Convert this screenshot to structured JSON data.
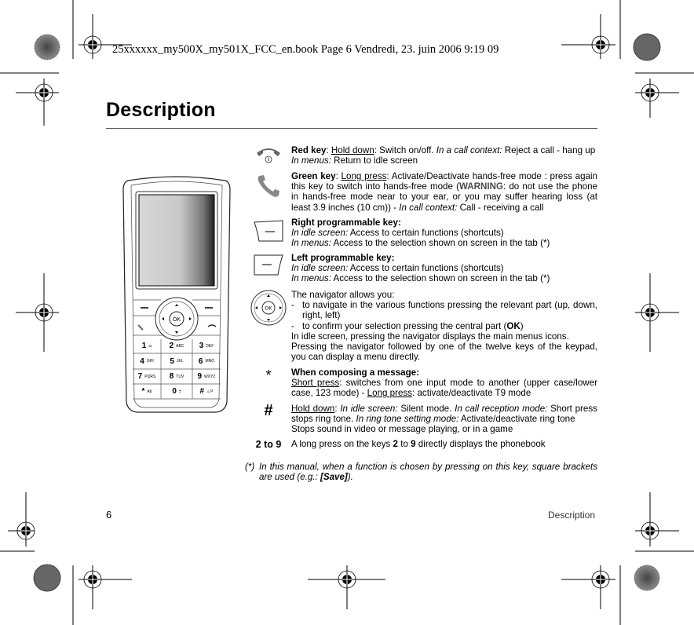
{
  "print_header": "25xxxxxx_my500X_my501X_FCC_en.book  Page 6  Vendredi, 23. juin 2006  9:19 09",
  "page": {
    "title": "Description",
    "page_number": "6",
    "running_footer": "Description"
  },
  "phone": {
    "keys": [
      {
        "digit": "1",
        "letters": "ω"
      },
      {
        "digit": "2",
        "letters": "ABC"
      },
      {
        "digit": "3",
        "letters": "DEF"
      },
      {
        "digit": "4",
        "letters": "GHI"
      },
      {
        "digit": "5",
        "letters": "JKL"
      },
      {
        "digit": "6",
        "letters": "MNO"
      },
      {
        "digit": "7",
        "letters": "PQRS"
      },
      {
        "digit": "8",
        "letters": "TUV"
      },
      {
        "digit": "9",
        "letters": "WXYZ"
      },
      {
        "digit": "*",
        "letters": "Ab"
      },
      {
        "digit": "0",
        "letters": "±"
      },
      {
        "digit": "#",
        "letters": "♫ P"
      }
    ],
    "ok_label": "OK"
  },
  "entries": {
    "red_key": {
      "icon": "red-key-hangup-icon",
      "title": "Red key",
      "action1": "Hold down",
      "text1": ": Switch on/off. ",
      "ctx1": "In a call context:",
      "text2": " Reject a call - hang up",
      "ctx2": "In menus:",
      "text3": " Return to idle screen"
    },
    "green_key": {
      "icon": "green-key-call-icon",
      "title": "Green key",
      "action1": "Long press",
      "text1": ": Activate/Deactivate hands-free mode : press again this key to switch into hands-free mode (",
      "warning": "WARNING",
      "text2": ": do not use the phone in hands-free mode near to your ear, or you may suffer hearing loss (at least 3.9 inches (10 cm)) - ",
      "ctx1": "In call context:",
      "text3": " Call - receiving a call"
    },
    "right_key": {
      "icon": "right-softkey-icon",
      "title": "Right programmable key:",
      "ctx1": "In idle screen:",
      "text1": " Access to certain functions (shortcuts)",
      "ctx2": "In menus:",
      "text2": " Access to the selection shown on screen in the tab (*)"
    },
    "left_key": {
      "icon": "left-softkey-icon",
      "title": "Left programmable key:",
      "ctx1": "In idle screen:",
      "text1": " Access to certain functions (shortcuts)",
      "ctx2": "In menus:",
      "text2": " Access to the selection shown on screen in the tab (*)"
    },
    "navigator": {
      "icon": "navigator-icon",
      "ok_label": "OK",
      "intro": "The navigator allows you:",
      "bullet1": "to navigate in the various functions pressing the relevant part (up, down, right, left)",
      "bullet2_pre": "to confirm your selection pressing the central part (",
      "bullet2_bold": "OK",
      "bullet2_post": ")",
      "line1": "In idle screen, pressing the navigator displays the main menus icons.",
      "line2": "Pressing the navigator followed by one of the twelve keys of the keypad, you can display a menu directly."
    },
    "star_key": {
      "symbol": "*",
      "title": "When composing a message:",
      "action1": "Short press",
      "text1": ": switches from one input mode to another (upper case/lower case, 123 mode) - ",
      "action2": "Long press",
      "text2": ": activate/deactivate T9 mode"
    },
    "hash_key": {
      "symbol": "#",
      "action1": "Hold down",
      "text1": ": ",
      "ctx1": "In idle screen:",
      "text2": " Silent mode. ",
      "ctx2": "In call reception mode:",
      "text3": " Short press stops ring tone. ",
      "ctx3": "In ring tone setting mode:",
      "text4": " Activate/deactivate ring tone",
      "line2": "Stops sound in video or message playing, or in a game"
    },
    "digit_keys": {
      "symbol": "2 to 9",
      "text1": "A long press on the keys ",
      "b1": "2",
      "text2": " to ",
      "b2": "9",
      "text3": " directly displays the phonebook"
    }
  },
  "footnote": {
    "mark": "(*)",
    "text1": "In this manual, when a function is chosen by pressing on this key, square brackets are used (e.g.: ",
    "bold": "[Save]",
    "text2": ")."
  }
}
